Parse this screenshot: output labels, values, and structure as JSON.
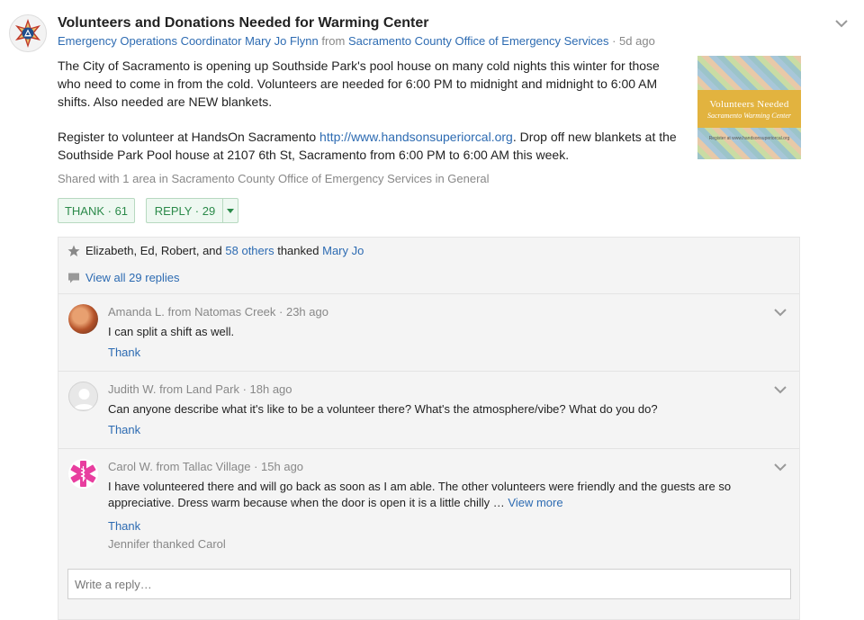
{
  "post": {
    "title": "Volunteers and Donations Needed for Warming Center",
    "author": "Emergency Operations Coordinator Mary Jo Flynn",
    "from_word": "from",
    "org": "Sacramento County Office of Emergency Services",
    "time": "· 5d ago",
    "body_p1": "The City of Sacramento is opening up Southside Park's pool house on many cold nights this winter for those who need to come in from the cold. Volunteers are needed for 6:00 PM to midnight and midnight to 6:00 AM shifts. Also needed are NEW blankets.",
    "body_p2_pre": "Register to volunteer at HandsOn Sacramento ",
    "body_p2_link": "http://www.handsonsuperiorcal.org",
    "body_p2_post": ". Drop off new blankets at the Southside Park Pool house at 2107 6th St, Sacramento from 6:00 PM to 6:00 AM this week.",
    "shared": "Shared with 1 area in Sacramento County Office of Emergency Services in General",
    "thumbnail": {
      "line1": "Volunteers Needed",
      "line2": "Sacramento Warming Center",
      "line3": "Register at www.handsonsuperiorcal.org",
      "banner_color": "#e2b33f"
    }
  },
  "actions": {
    "thank_label": "THANK · 61",
    "reply_label": "REPLY · 29",
    "accent_color": "#2b8a4a"
  },
  "thanked": {
    "names": "Elizabeth, Ed, Robert, and",
    "others_link": "58 others",
    "middle": "thanked",
    "target": "Mary Jo"
  },
  "view_all": "View all 29 replies",
  "replies": [
    {
      "author": "Amanda L. from Natomas Creek",
      "time": "· 23h ago",
      "text": "I can split a shift as well.",
      "thank": "Thank"
    },
    {
      "author": "Judith W. from Land Park",
      "time": "· 18h ago",
      "text": "Can anyone describe what it's like to be a volunteer there? What's the atmosphere/vibe? What do you do?",
      "thank": "Thank"
    },
    {
      "author": "Carol W. from Tallac Village",
      "time": "· 15h ago",
      "text": "I have volunteered there and will go back as soon as I am able. The other volunteers were friendly and the guests are so appreciative. Dress warm because when the door is open it is a little chilly …",
      "view_more": "View more",
      "thank": "Thank",
      "footer": "Jennifer thanked Carol"
    }
  ],
  "reply_box": {
    "placeholder": "Write a reply…"
  },
  "icons": {
    "org_badge": "emergency-star-badge-icon",
    "chevron": "chevron-down-icon",
    "star": "star-icon",
    "comments": "speech-bubble-icon"
  },
  "colors": {
    "link": "#2d6bb2",
    "muted": "#888888",
    "replies_bg": "#f4f4f4"
  }
}
